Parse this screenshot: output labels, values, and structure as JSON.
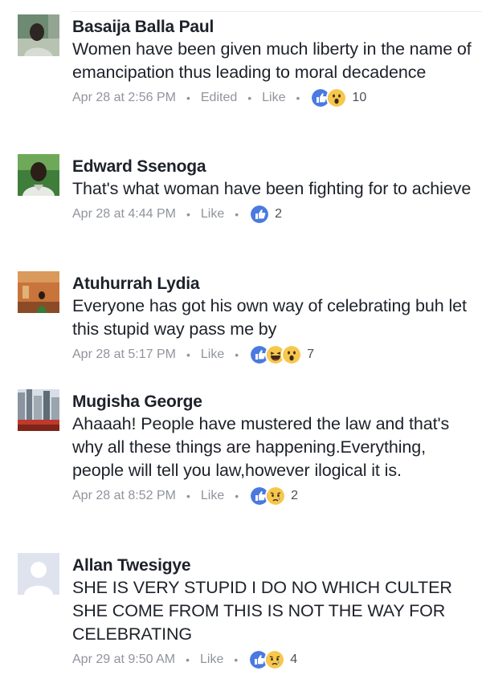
{
  "comments": [
    {
      "author": "Basaija Balla Paul",
      "text": "Women have been given much liberty in the name of emancipation thus leading to moral decadence",
      "time": "Apr 28 at 2:56 PM",
      "edited": "Edited",
      "like_label": "Like",
      "reactions": [
        "like",
        "wow"
      ],
      "count": "10"
    },
    {
      "author": "Edward Ssenoga",
      "text": "That's what woman have been fighting for to achieve",
      "time": "Apr 28 at 4:44 PM",
      "like_label": "Like",
      "reactions": [
        "like"
      ],
      "count": "2"
    },
    {
      "author": "Atuhurrah Lydia",
      "text": "Everyone has got his own way of celebrating buh let this stupid way pass me by",
      "time": "Apr 28 at 5:17 PM",
      "like_label": "Like",
      "reactions": [
        "like",
        "haha",
        "wow"
      ],
      "count": "7"
    },
    {
      "author": "Mugisha George",
      "text": "Ahaaah! People have mustered the law and that's why all these things are happening.Everything, people will tell you law,however ilogical it is.",
      "time": "Apr 28 at 8:52 PM",
      "like_label": "Like",
      "reactions": [
        "like",
        "sad"
      ],
      "count": "2"
    },
    {
      "author": "Allan Twesigye",
      "text": "SHE IS VERY STUPID  I DO NO WHICH CULTER SHE COME FROM THIS IS NOT THE WAY FOR CELEBRATING",
      "time": "Apr 29 at 9:50 AM",
      "like_label": "Like",
      "reactions": [
        "like",
        "sad"
      ],
      "count": "4"
    }
  ],
  "colors": {
    "name": "#1d2129",
    "meta": "#90949c",
    "like_blue": "#4267b2",
    "emoji_yellow": "#f7c74c"
  }
}
